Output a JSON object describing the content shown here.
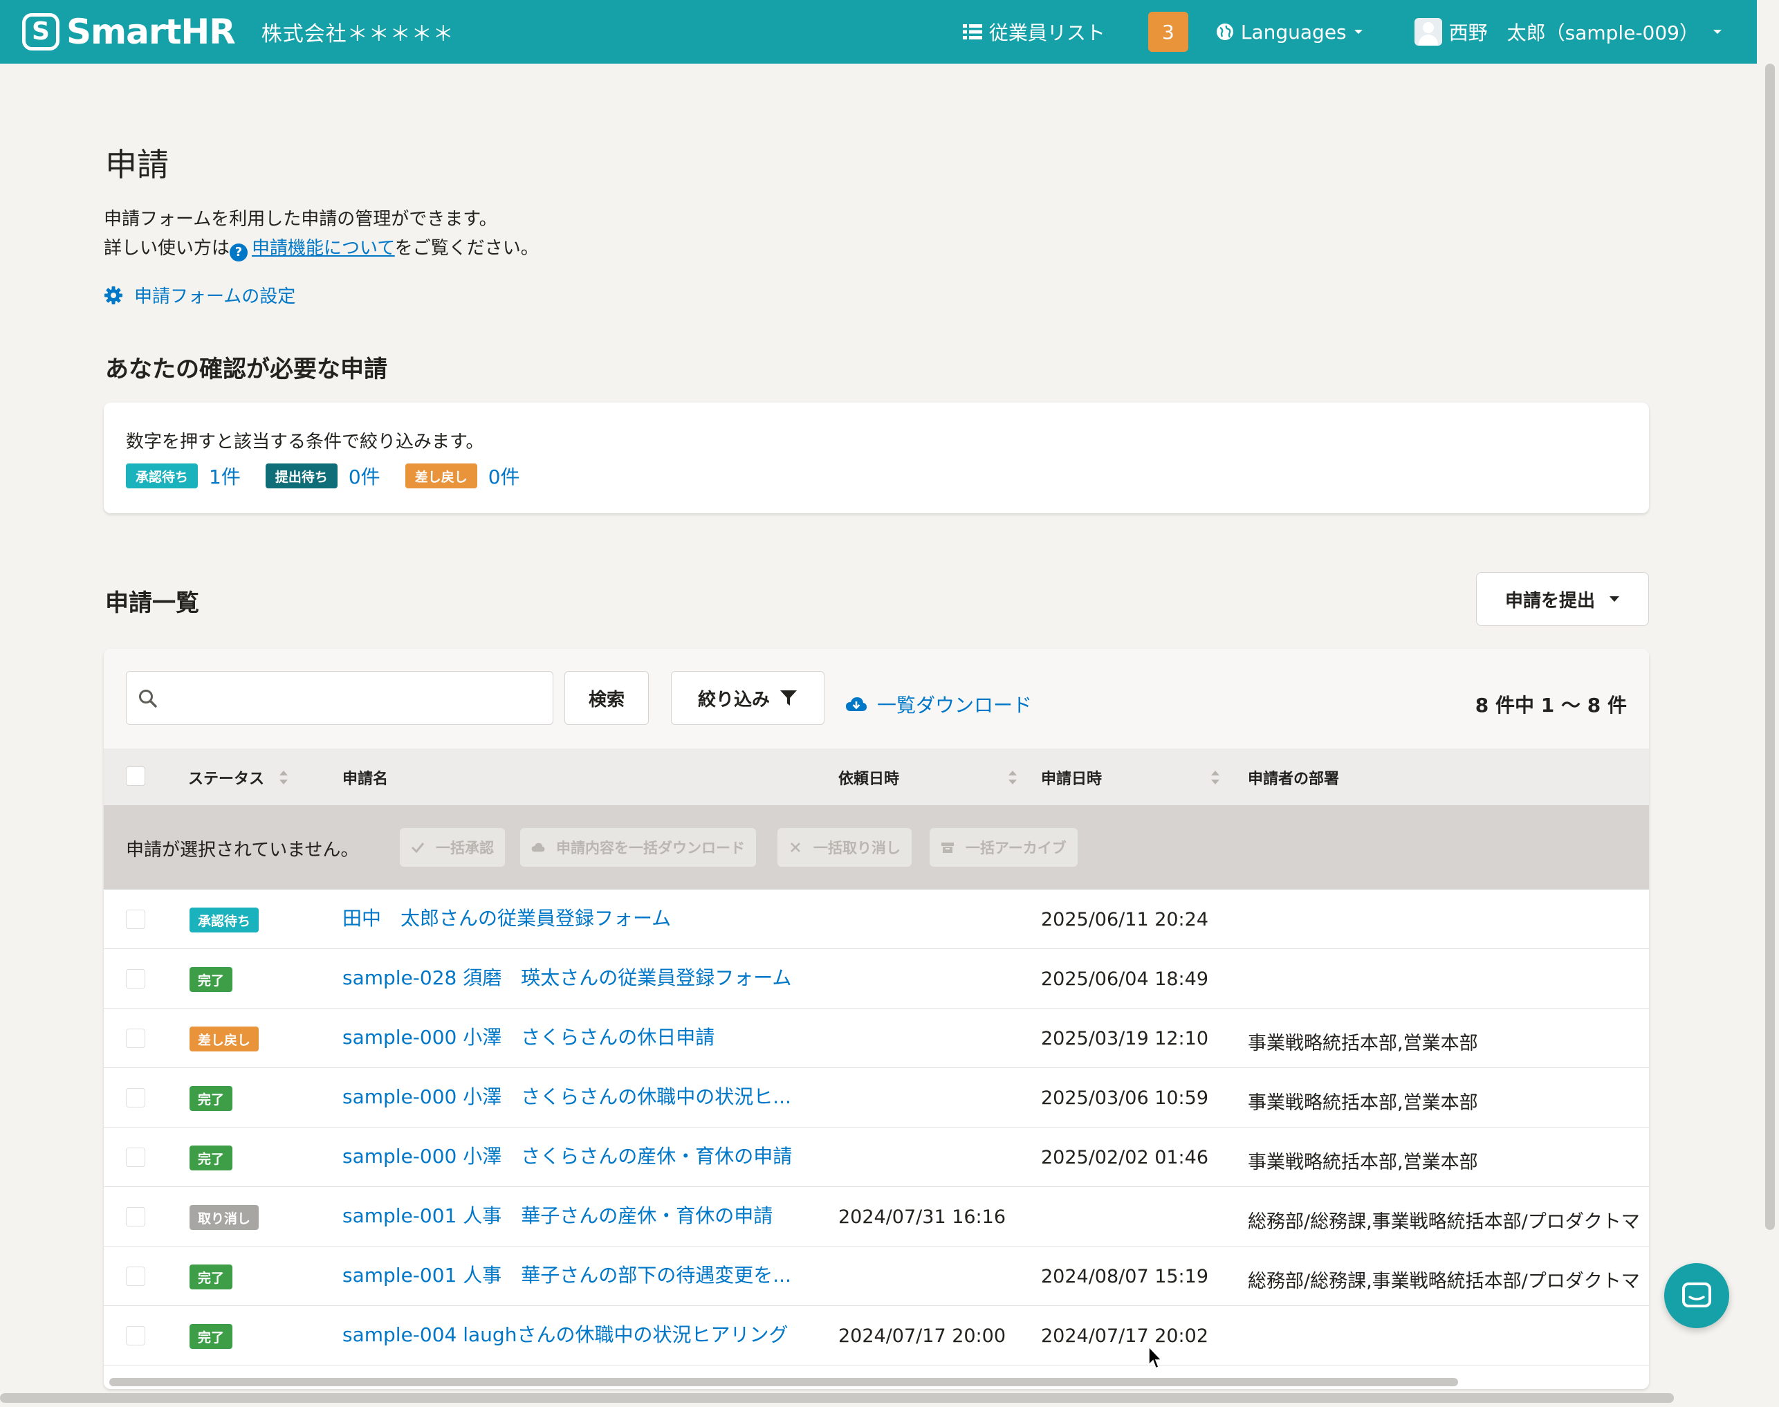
{
  "header": {
    "logo_mark": "S",
    "logo_text": "SmartHR",
    "company": "株式会社＊＊＊＊＊",
    "employee_list": "従業員リスト",
    "notification_count": "3",
    "languages": "Languages",
    "user_name": "西野　太郎（sample-009）",
    "brand_color": "#16a1a9"
  },
  "page": {
    "title": "申請",
    "desc_line1": "申請フォームを利用した申請の管理ができます。",
    "desc_line2_prefix": "詳しい使い方は",
    "help_icon": "?",
    "desc_link": "申請機能について",
    "desc_line2_suffix": "をご覧ください。",
    "settings_link": "申請フォームの設定"
  },
  "confirm": {
    "title": "あなたの確認が必要な申請",
    "note": "数字を押すと該当する条件で絞り込みます。",
    "filters": [
      {
        "label": "承認待ち",
        "count": "1件",
        "color": "#1ab2bd"
      },
      {
        "label": "提出待ち",
        "count": "0件",
        "color": "#0f6e78"
      },
      {
        "label": "差し戻し",
        "count": "0件",
        "color": "#e9933b"
      }
    ]
  },
  "list": {
    "title": "申請一覧",
    "submit_button": "申請を提出",
    "search_placeholder": "",
    "search_button": "検索",
    "filter_button": "絞り込み",
    "download_link": "一覧ダウンロード",
    "pager": "8 件中 1 〜 8 件",
    "columns": {
      "status": "ステータス",
      "name": "申請名",
      "requested": "依頼日時",
      "applied": "申請日時",
      "dept": "申請者の部署"
    },
    "bulk": {
      "note": "申請が選択されていません。",
      "approve": "一括承認",
      "download": "申請内容を一括ダウンロード",
      "cancel": "一括取り消し",
      "archive": "一括アーカイブ"
    },
    "rows": [
      {
        "status": "承認待ち",
        "color": "#1ab2bd",
        "name": "田中　太郎さんの従業員登録フォーム",
        "requested": "",
        "applied": "2025/06/11 20:24",
        "dept": ""
      },
      {
        "status": "完了",
        "color": "#3e9e48",
        "name": "sample-028 須磨　瑛太さんの従業員登録フォーム",
        "requested": "",
        "applied": "2025/06/04 18:49",
        "dept": ""
      },
      {
        "status": "差し戻し",
        "color": "#e9933b",
        "name": "sample-000 小澤　さくらさんの休日申請",
        "requested": "",
        "applied": "2025/03/19 12:10",
        "dept": "事業戦略統括本部,営業本部"
      },
      {
        "status": "完了",
        "color": "#3e9e48",
        "name": "sample-000 小澤　さくらさんの休職中の状況ヒ...",
        "requested": "",
        "applied": "2025/03/06 10:59",
        "dept": "事業戦略統括本部,営業本部"
      },
      {
        "status": "完了",
        "color": "#3e9e48",
        "name": "sample-000 小澤　さくらさんの産休・育休の申請",
        "requested": "",
        "applied": "2025/02/02 01:46",
        "dept": "事業戦略統括本部,営業本部"
      },
      {
        "status": "取り消し",
        "color": "#a8a6a2",
        "name": "sample-001 人事　華子さんの産休・育休の申請",
        "requested": "2024/07/31 16:16",
        "applied": "",
        "dept": "総務部/総務課,事業戦略統括本部/プロダクトマ"
      },
      {
        "status": "完了",
        "color": "#3e9e48",
        "name": "sample-001 人事　華子さんの部下の待遇変更を...",
        "requested": "",
        "applied": "2024/08/07 15:19",
        "dept": "総務部/総務課,事業戦略統括本部/プロダクトマ"
      },
      {
        "status": "完了",
        "color": "#3e9e48",
        "name": "sample-004 laughさんの休職中の状況ヒアリング",
        "requested": "2024/07/17 20:00",
        "applied": "2024/07/17 20:02",
        "dept": ""
      }
    ]
  }
}
